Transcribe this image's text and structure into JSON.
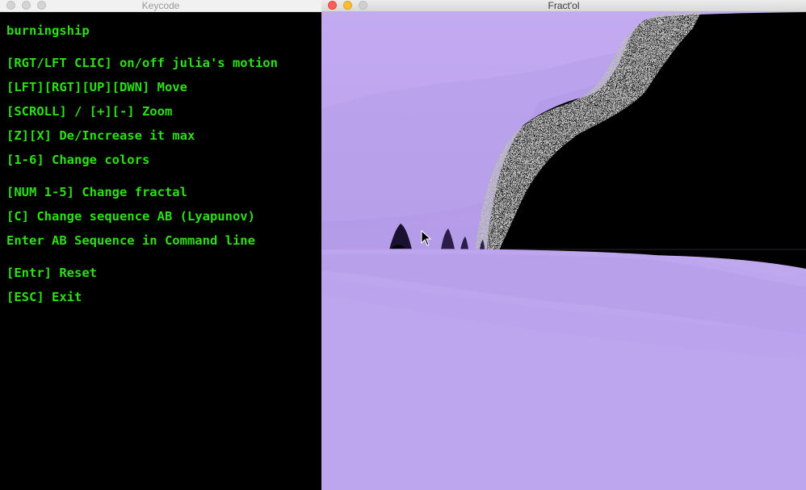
{
  "keycode_window": {
    "title": "Keycode",
    "lines": [
      "burningship",
      "[RGT/LFT CLIC] on/off julia's motion",
      "[LFT][RGT][UP][DWN] Move",
      "[SCROLL] / [+][-] Zoom",
      "[Z][X] De/Increase it max",
      "[1-6] Change colors",
      "[NUM 1-5] Change fractal",
      "[C] Change sequence AB (Lyapunov)",
      "Enter AB Sequence in Command line",
      "[Entr] Reset",
      "[ESC] Exit"
    ]
  },
  "fractol_window": {
    "title": "Fract'ol"
  },
  "colors": {
    "terminal_text": "#2ce014",
    "fractal_lavender": "#c0a8ef",
    "fractal_dark": "#000000"
  },
  "icons": {
    "close": "close-icon",
    "minimize": "minimize-icon",
    "zoom": "zoom-icon",
    "cursor": "arrow-cursor-icon"
  }
}
